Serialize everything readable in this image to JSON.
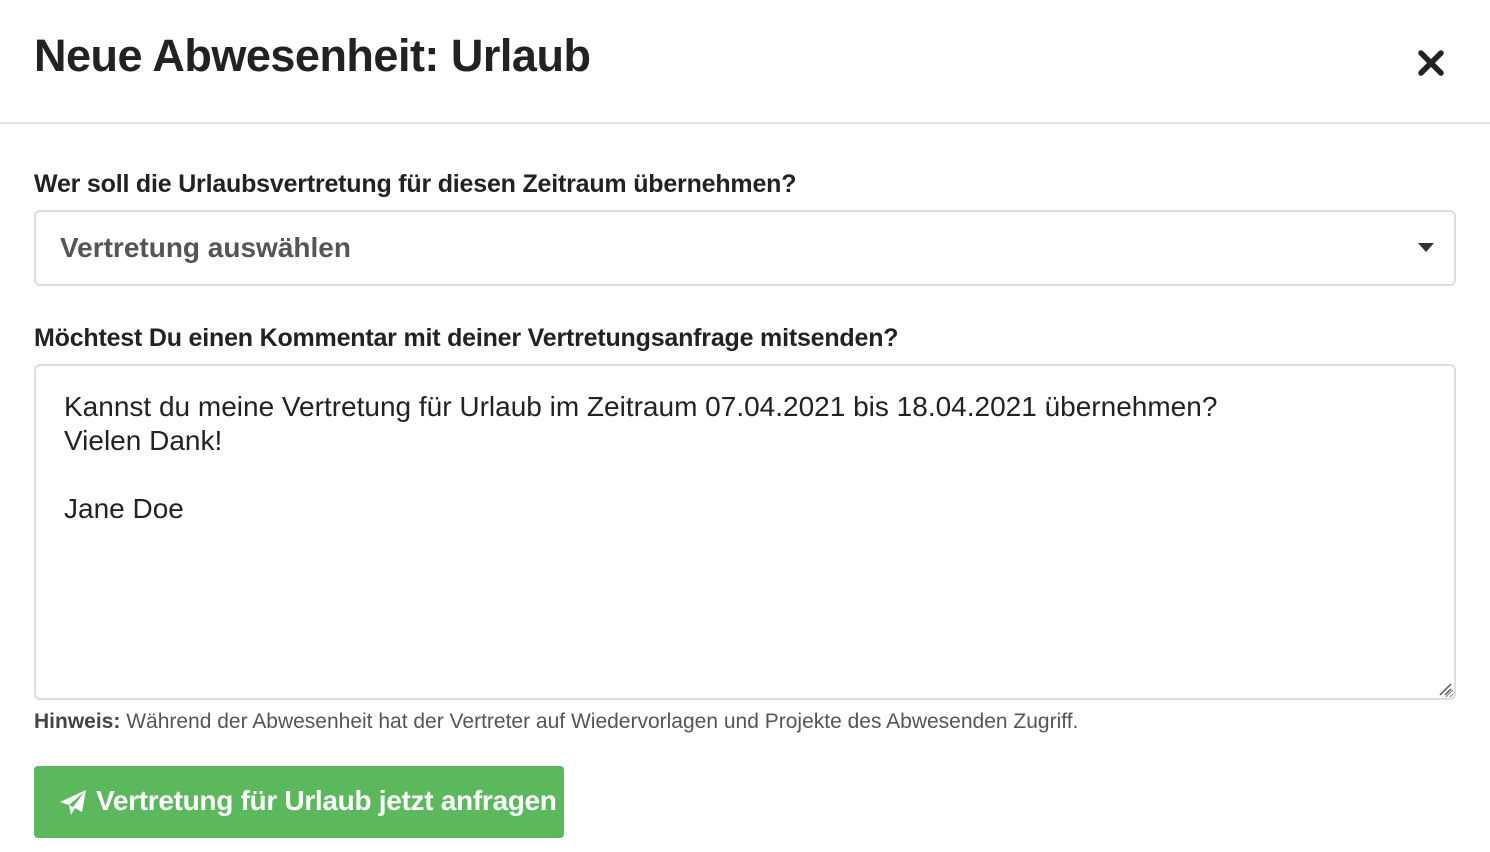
{
  "modal": {
    "title": "Neue Abwesenheit: Urlaub",
    "close_icon": "close-icon"
  },
  "substitute": {
    "label": "Wer soll die Urlaubsvertretung für diesen Zeitraum übernehmen?",
    "selected_value": "Vertretung auswählen",
    "caret_icon": "caret-down-icon"
  },
  "comment": {
    "label": "Möchtest Du einen Kommentar mit deiner Vertretungsanfrage mitsenden?",
    "value": "Kannst du meine Vertretung für Urlaub im Zeitraum 07.04.2021 bis 18.04.2021 übernehmen?\nVielen Dank!\n\nJane Doe"
  },
  "hint": {
    "label": "Hinweis:",
    "text": " Während der Abwesenheit hat der Vertreter auf Wiedervorlagen und Projekte des Abwesenden Zugriff."
  },
  "submit": {
    "label": "Vertretung für Urlaub jetzt anfragen",
    "icon": "paper-plane-icon"
  },
  "colors": {
    "primary_button": "#5cb85c",
    "border": "#dcdcdc",
    "text": "#222222"
  }
}
